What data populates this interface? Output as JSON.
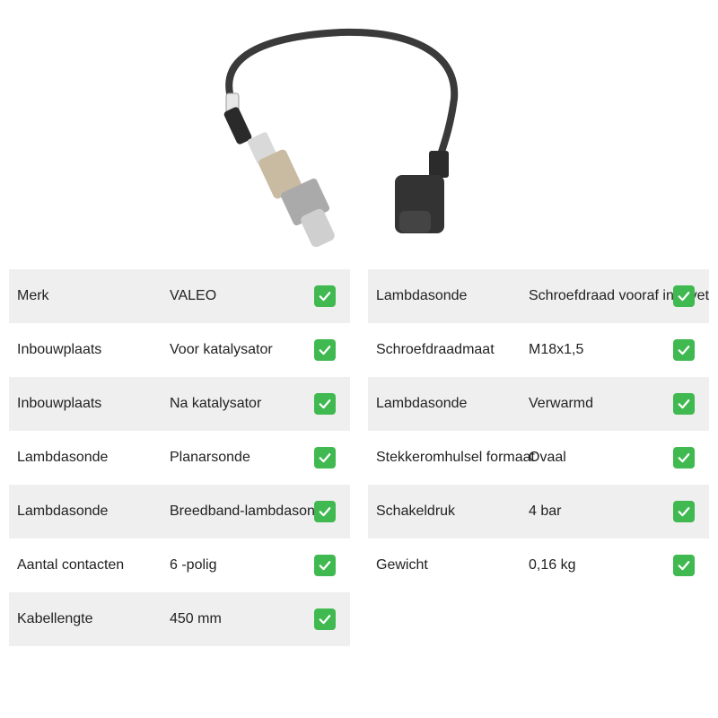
{
  "product_image": {
    "alt": "lambda-sensor-photo"
  },
  "specs": {
    "left": [
      {
        "label": "Merk",
        "value": "VALEO"
      },
      {
        "label": "Inbouwplaats",
        "value": "Voor katalysator"
      },
      {
        "label": "Inbouwplaats",
        "value": "Na katalysator"
      },
      {
        "label": "Lambdasonde",
        "value": "Planarsonde"
      },
      {
        "label": "Lambdasonde",
        "value": "Breedband-lambdasonde"
      },
      {
        "label": "Aantal contacten",
        "value": "6 -polig"
      },
      {
        "label": "Kabellengte",
        "value": "450 mm"
      }
    ],
    "right": [
      {
        "label": "Lambdasonde",
        "value": "Schroefdraad vooraf ingevet"
      },
      {
        "label": "Schroefdraadmaat",
        "value": "M18x1,5"
      },
      {
        "label": "Lambdasonde",
        "value": "Verwarmd"
      },
      {
        "label": "Stekkeromhulsel formaat",
        "value": "Ovaal"
      },
      {
        "label": "Schakeldruk",
        "value": "4 bar"
      },
      {
        "label": "Gewicht",
        "value": "0,16 kg"
      }
    ]
  },
  "colors": {
    "check": "#3fb950",
    "row_shade": "#efefef"
  },
  "icons": {
    "check": "check-icon"
  }
}
